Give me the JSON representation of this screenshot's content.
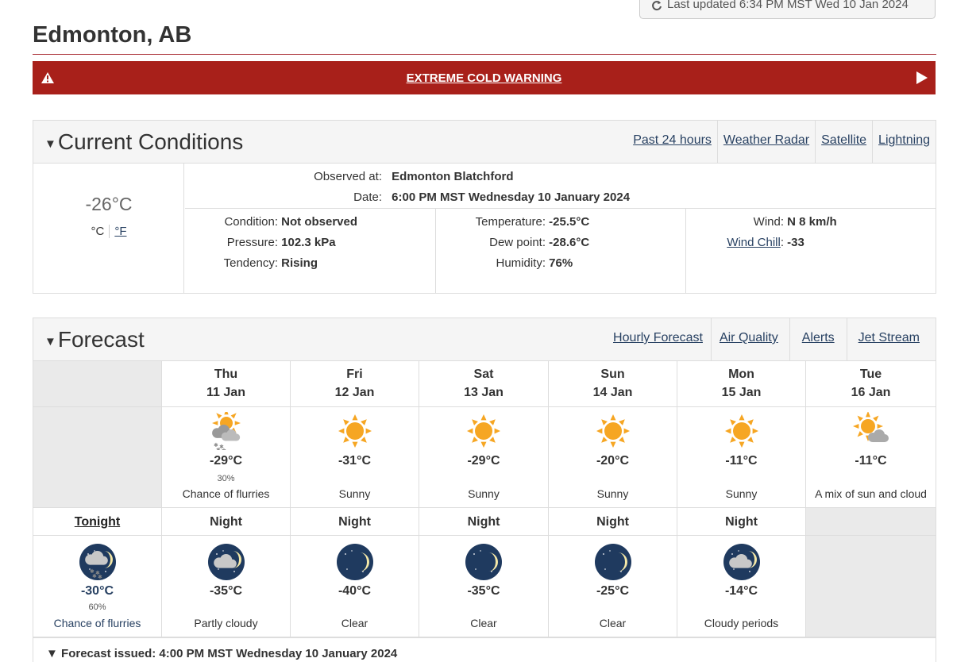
{
  "last_updated": "Last updated 6:34 PM MST Wed 10 Jan 2024",
  "city": "Edmonton, AB",
  "warning": "EXTREME COLD WARNING",
  "colors": {
    "warning_bg": "#a8201a",
    "link": "#284162",
    "sun": "#f6a623",
    "moon_bg": "#1f3a5f"
  },
  "current": {
    "title": "Current Conditions",
    "links": [
      "Past 24 hours",
      "Weather Radar",
      "Satellite",
      "Lightning"
    ],
    "temp": "-26°C",
    "unit_c": "°C",
    "unit_f": "°F",
    "observed_label": "Observed at:",
    "observed_value": "Edmonton Blatchford",
    "date_label": "Date:",
    "date_value": "6:00 PM MST Wednesday 10 January 2024",
    "condition_label": "Condition:",
    "condition_value": "Not observed",
    "pressure_label": "Pressure:",
    "pressure_value": "102.3 kPa",
    "tendency_label": "Tendency:",
    "tendency_value": "Rising",
    "temperature_label": "Temperature:",
    "temperature_value": "-25.5°C",
    "dewpoint_label": "Dew point:",
    "dewpoint_value": "-28.6°C",
    "humidity_label": "Humidity:",
    "humidity_value": "76%",
    "wind_label": "Wind:",
    "wind_value": "N 8 km/h",
    "windchill_label": "Wind Chill",
    "windchill_value": "-33"
  },
  "forecast": {
    "title": "Forecast",
    "links": [
      "Hourly Forecast",
      "Air Quality",
      "Alerts",
      "Jet Stream"
    ],
    "days": [
      {
        "day": "Thu",
        "date": "11 Jan",
        "temp": "-29°C",
        "pop": "30%",
        "summary": "Chance of flurries",
        "icon": "sun-cloud-snow-icon"
      },
      {
        "day": "Fri",
        "date": "12 Jan",
        "temp": "-31°C",
        "pop": "",
        "summary": "Sunny",
        "icon": "sun-icon"
      },
      {
        "day": "Sat",
        "date": "13 Jan",
        "temp": "-29°C",
        "pop": "",
        "summary": "Sunny",
        "icon": "sun-icon"
      },
      {
        "day": "Sun",
        "date": "14 Jan",
        "temp": "-20°C",
        "pop": "",
        "summary": "Sunny",
        "icon": "sun-icon"
      },
      {
        "day": "Mon",
        "date": "15 Jan",
        "temp": "-11°C",
        "pop": "",
        "summary": "Sunny",
        "icon": "sun-icon"
      },
      {
        "day": "Tue",
        "date": "16 Jan",
        "temp": "-11°C",
        "pop": "",
        "summary": "A mix of sun and cloud",
        "icon": "sun-cloud-icon"
      }
    ],
    "nights": [
      {
        "label": "Tonight",
        "temp": "-30°C",
        "pop": "60%",
        "summary": "Chance of flurries",
        "icon": "moon-cloud-snow-icon"
      },
      {
        "label": "Night",
        "temp": "-35°C",
        "pop": "",
        "summary": "Partly cloudy",
        "icon": "moon-cloud-icon"
      },
      {
        "label": "Night",
        "temp": "-40°C",
        "pop": "",
        "summary": "Clear",
        "icon": "moon-icon"
      },
      {
        "label": "Night",
        "temp": "-35°C",
        "pop": "",
        "summary": "Clear",
        "icon": "moon-icon"
      },
      {
        "label": "Night",
        "temp": "-25°C",
        "pop": "",
        "summary": "Clear",
        "icon": "moon-icon"
      },
      {
        "label": "Night",
        "temp": "-14°C",
        "pop": "",
        "summary": "Cloudy periods",
        "icon": "moon-cloud-icon"
      }
    ],
    "issued": "Forecast issued: 4:00 PM MST Wednesday 10 January 2024"
  }
}
